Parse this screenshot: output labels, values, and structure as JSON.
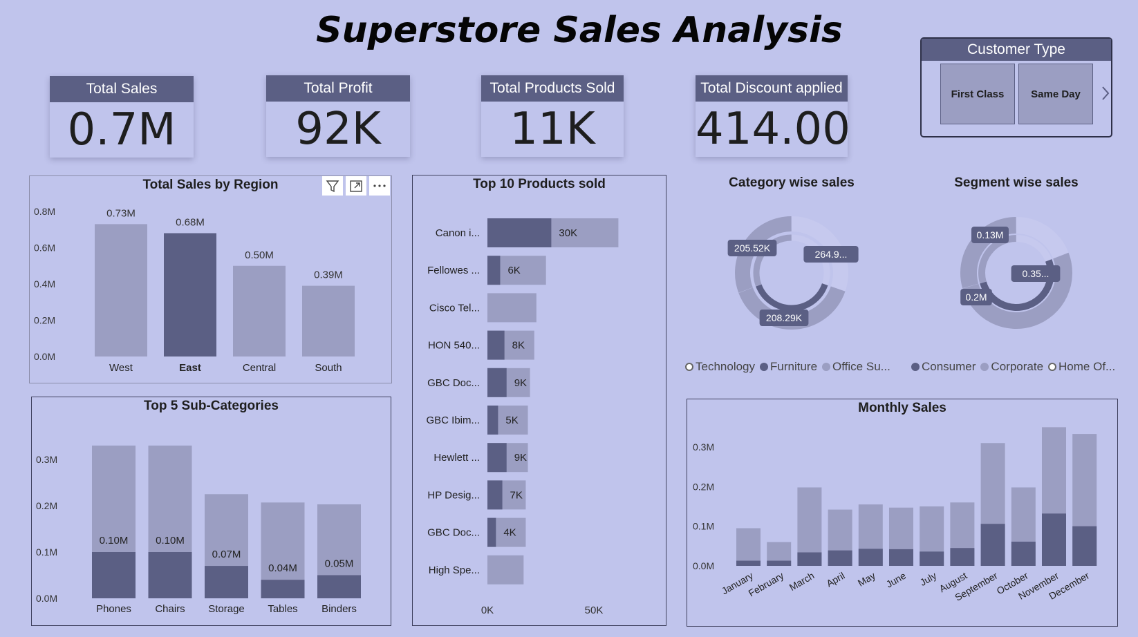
{
  "title": "Superstore Sales Analysis",
  "kpis": [
    {
      "label": "Total Sales",
      "value": "0.7M"
    },
    {
      "label": "Total Profit",
      "value": "92K"
    },
    {
      "label": "Total Products Sold",
      "value": "11K"
    },
    {
      "label": "Total Discount applied",
      "value": "414.00"
    }
  ],
  "slicer": {
    "title": "Customer Type",
    "options": [
      "First Class",
      "Same Day"
    ]
  },
  "colors": {
    "background": "#c0c4ec",
    "light": "#9b9ec2",
    "dark": "#5b5f84"
  },
  "visual_icons": [
    "filter-icon",
    "focus-mode-icon",
    "more-options-icon"
  ],
  "chart_data": [
    {
      "id": "region",
      "type": "bar",
      "title": "Total Sales by Region",
      "categories": [
        "West",
        "East",
        "Central",
        "South"
      ],
      "values": [
        0.73,
        0.68,
        0.5,
        0.39
      ],
      "labels": [
        "0.73M",
        "0.68M",
        "0.50M",
        "0.39M"
      ],
      "highlighted": "East",
      "yticks": [
        "0.0M",
        "0.2M",
        "0.4M",
        "0.6M",
        "0.8M"
      ],
      "ylim": [
        0,
        0.8
      ]
    },
    {
      "id": "subcat",
      "type": "bar",
      "title": "Top 5 Sub-Categories",
      "categories": [
        "Phones",
        "Chairs",
        "Storage",
        "Tables",
        "Binders"
      ],
      "series": [
        {
          "values": [
            0.1,
            0.1,
            0.07,
            0.04,
            0.05
          ],
          "labels": [
            "0.10M",
            "0.10M",
            "0.07M",
            "0.04M",
            "0.05M"
          ]
        },
        {
          "values": [
            0.33,
            0.33,
            0.225,
            0.207,
            0.203
          ]
        }
      ],
      "yticks": [
        "0.0M",
        "0.1M",
        "0.2M",
        "0.3M"
      ],
      "ylim": [
        0,
        0.3
      ]
    },
    {
      "id": "products",
      "type": "bar",
      "orientation": "horizontal",
      "title": "Top 10 Products sold",
      "categories": [
        "Canon i...",
        "Fellowes ...",
        "Cisco Tel...",
        "HON 540...",
        "GBC Doc...",
        "GBC Ibim...",
        "Hewlett ...",
        "HP Desig...",
        "GBC Doc...",
        "High Spe..."
      ],
      "series": [
        {
          "values": [
            30,
            6,
            0,
            8,
            9,
            5,
            9,
            7,
            4,
            0
          ],
          "labels": [
            "30K",
            "6K",
            "",
            "8K",
            "9K",
            "5K",
            "9K",
            "7K",
            "4K",
            ""
          ]
        },
        {
          "values": [
            61.5,
            27.5,
            23,
            22,
            20,
            19,
            19,
            18,
            18,
            17
          ]
        }
      ],
      "xticks": [
        "0K",
        "50K"
      ],
      "xlim": [
        0,
        50
      ]
    },
    {
      "id": "category",
      "type": "pie",
      "title": "Category wise sales",
      "legend": [
        "Technology",
        "Furniture",
        "Office Su..."
      ],
      "labels": [
        "205.52K",
        "264.9...",
        "208.29K"
      ],
      "values": [
        205.52,
        264.9,
        208.29
      ]
    },
    {
      "id": "segment",
      "type": "pie",
      "title": "Segment wise sales",
      "legend": [
        "Consumer",
        "Corporate",
        "Home Of..."
      ],
      "labels": [
        "0.13M",
        "0.35...",
        "0.2M"
      ],
      "values": [
        0.13,
        0.35,
        0.2
      ]
    },
    {
      "id": "monthly",
      "type": "bar",
      "title": "Monthly Sales",
      "categories": [
        "January",
        "February",
        "March",
        "April",
        "May",
        "June",
        "July",
        "August",
        "September",
        "October",
        "November",
        "December"
      ],
      "series": [
        {
          "values": [
            0.013,
            0.013,
            0.034,
            0.039,
            0.043,
            0.042,
            0.036,
            0.045,
            0.106,
            0.061,
            0.132,
            0.1
          ]
        },
        {
          "values": [
            0.095,
            0.06,
            0.198,
            0.142,
            0.155,
            0.147,
            0.15,
            0.16,
            0.31,
            0.198,
            0.35,
            0.333
          ]
        }
      ],
      "yticks": [
        "0.0M",
        "0.1M",
        "0.2M",
        "0.3M"
      ],
      "ylim": [
        0,
        0.3
      ]
    }
  ]
}
